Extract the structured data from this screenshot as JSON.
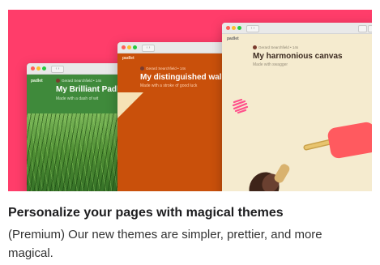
{
  "hero": {
    "background_color": "#ff3d6a",
    "windows": [
      {
        "brand": "padlet",
        "author": "Gerard Searchfield",
        "time": "14s",
        "title": "My Brilliant Padlet",
        "subtitle": "Made with a dash of wit",
        "color": "#3f8a3b"
      },
      {
        "brand": "padlet",
        "author": "Gerard Searchfield",
        "time": "14s",
        "title": "My distinguished wall",
        "subtitle": "Made with a stroke of good luck",
        "color": "#c9500b"
      },
      {
        "brand": "padlet",
        "author": "Gerard Searchfield",
        "time": "14s",
        "title": "My harmonious canvas",
        "subtitle": "Made with swagger",
        "color": "#f5ebcf"
      }
    ]
  },
  "heading": "Personalize your pages with magical themes",
  "description": "(Premium) Our new themes are simpler, prettier, and more magical."
}
